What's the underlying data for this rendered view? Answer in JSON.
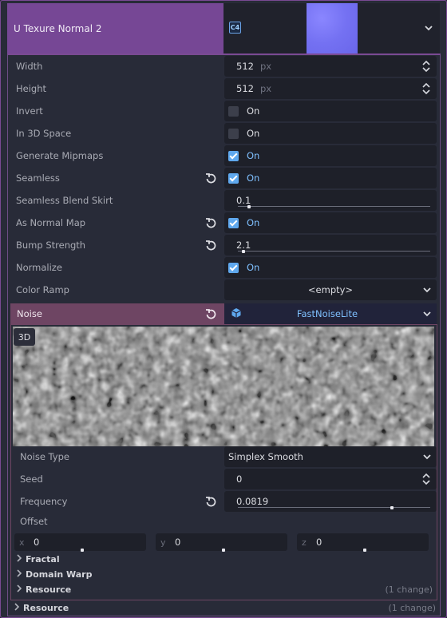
{
  "header": {
    "title": "U Texure Normal 2",
    "texture_icon_label": "C4"
  },
  "properties": [
    {
      "label": "Width",
      "value": "512",
      "unit": "px"
    },
    {
      "label": "Height",
      "value": "512",
      "unit": "px"
    },
    {
      "label": "Invert",
      "value": "On",
      "checked": false
    },
    {
      "label": "In 3D Space",
      "value": "On",
      "checked": false
    },
    {
      "label": "Generate Mipmaps",
      "value": "On",
      "checked": true
    },
    {
      "label": "Seamless",
      "value": "On",
      "checked": true
    },
    {
      "label": "Seamless Blend Skirt",
      "value": "0.1",
      "slider_fraction": 0.06
    },
    {
      "label": "As Normal Map",
      "value": "On",
      "checked": true
    },
    {
      "label": "Bump Strength",
      "value": "2.1",
      "slider_fraction": 0.03
    },
    {
      "label": "Normalize",
      "value": "On",
      "checked": true
    },
    {
      "label": "Color Ramp",
      "value": "<empty>"
    }
  ],
  "noise": {
    "label": "Noise",
    "resource": "FastNoiseLite",
    "preview_badge": "3D",
    "noise_type_label": "Noise Type",
    "noise_type_value": "Simplex Smooth",
    "seed_label": "Seed",
    "seed_value": "0",
    "frequency_label": "Frequency",
    "frequency_value": "0.0819",
    "frequency_slider_fraction": 0.8,
    "offset_label": "Offset",
    "offset": [
      {
        "axis": "x",
        "value": "0"
      },
      {
        "axis": "y",
        "value": "0"
      },
      {
        "axis": "z",
        "value": "0"
      }
    ],
    "groups": [
      {
        "label": "Fractal",
        "change": ""
      },
      {
        "label": "Domain Warp",
        "change": ""
      },
      {
        "label": "Resource",
        "change": "(1 change)"
      }
    ]
  },
  "footer": {
    "label": "Resource",
    "change": "(1 change)"
  },
  "colors": {
    "header_bg": "#764795",
    "noise_bg": "#6e4563",
    "accent_blue": "#5fa8ee"
  }
}
